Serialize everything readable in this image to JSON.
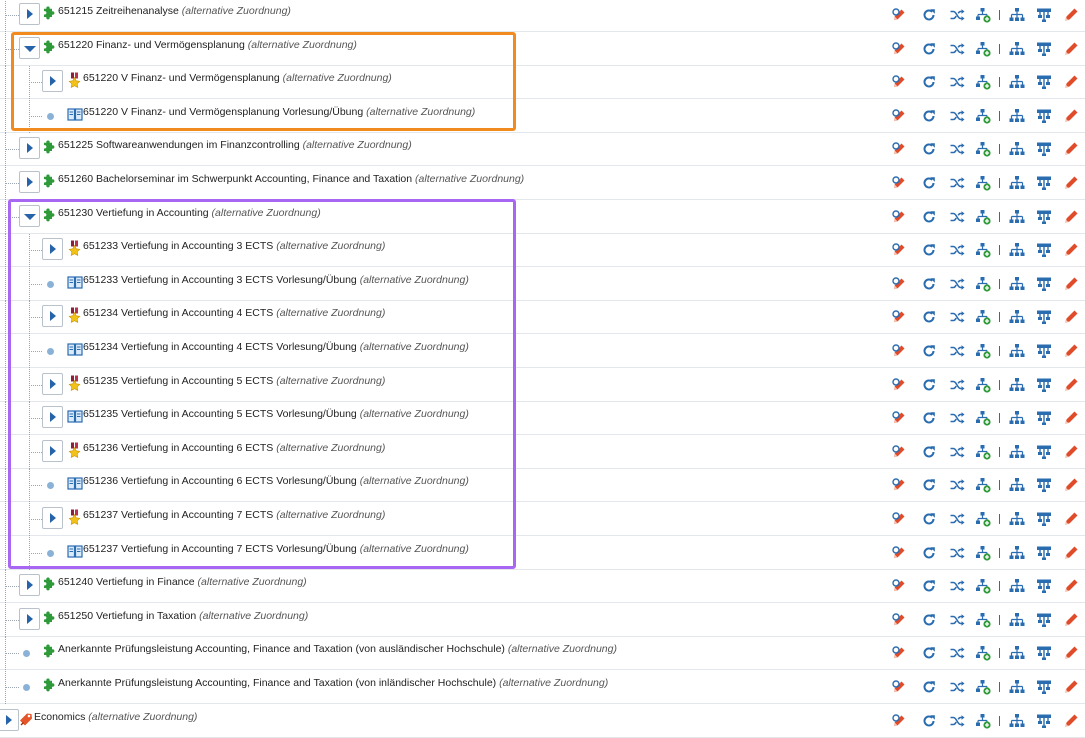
{
  "alt_label": "(alternative Zuordnung)",
  "colors": {
    "highlight_orange": "#f18a1f",
    "highlight_purple": "#a867f2",
    "toggle_arrow": "#2663a8",
    "action_blue": "#2a6cb0",
    "edit_red": "#e04b2a",
    "module_green": "#2e9a3a"
  },
  "action_icons": [
    "edit-pencil-icon",
    "refresh-icon",
    "shuffle-icon",
    "add-node-icon",
    "hierarchy-icon",
    "tree-structure-icon",
    "delete-pencil-icon"
  ],
  "rows": [
    {
      "level": 1,
      "toggle": "collapsed",
      "icon": "puzzle-icon",
      "title": "651215 Zeitreihenanalyse",
      "alt": true
    },
    {
      "level": 1,
      "toggle": "expanded",
      "icon": "puzzle-icon",
      "title": "651220 Finanz- und Vermögensplanung",
      "alt": true
    },
    {
      "level": 2,
      "toggle": "collapsed",
      "icon": "exam-medal-icon",
      "title": "651220 V Finanz- und Vermögensplanung",
      "alt": true
    },
    {
      "level": 2,
      "toggle": "leaf",
      "icon": "course-book-icon",
      "title": "651220 V Finanz- und Vermögensplanung Vorlesung/Übung",
      "alt": true
    },
    {
      "level": 1,
      "toggle": "collapsed",
      "icon": "puzzle-icon",
      "title": "651225 Softwareanwendungen im Finanzcontrolling",
      "alt": true
    },
    {
      "level": 1,
      "toggle": "collapsed",
      "icon": "puzzle-icon",
      "title": "651260 Bachelorseminar im Schwerpunkt Accounting, Finance and Taxation",
      "alt": true
    },
    {
      "level": 1,
      "toggle": "expanded",
      "icon": "puzzle-icon",
      "title": "651230 Vertiefung in Accounting",
      "alt": true
    },
    {
      "level": 2,
      "toggle": "collapsed",
      "icon": "exam-medal-icon",
      "title": "651233 Vertiefung in Accounting 3 ECTS",
      "alt": true
    },
    {
      "level": 2,
      "toggle": "leaf",
      "icon": "course-book-icon",
      "title": "651233 Vertiefung in Accounting 3 ECTS Vorlesung/Übung",
      "alt": true
    },
    {
      "level": 2,
      "toggle": "collapsed",
      "icon": "exam-medal-icon",
      "title": "651234 Vertiefung in Accounting 4 ECTS",
      "alt": true
    },
    {
      "level": 2,
      "toggle": "leaf",
      "icon": "course-book-icon",
      "title": "651234 Vertiefung in Accounting 4 ECTS Vorlesung/Übung",
      "alt": true
    },
    {
      "level": 2,
      "toggle": "collapsed",
      "icon": "exam-medal-icon",
      "title": "651235 Vertiefung in Accounting 5 ECTS",
      "alt": true
    },
    {
      "level": 2,
      "toggle": "collapsed",
      "icon": "course-book-icon",
      "title": "651235 Vertiefung in Accounting 5 ECTS Vorlesung/Übung",
      "alt": true
    },
    {
      "level": 2,
      "toggle": "collapsed",
      "icon": "exam-medal-icon",
      "title": "651236 Vertiefung in Accounting 6 ECTS",
      "alt": true
    },
    {
      "level": 2,
      "toggle": "leaf",
      "icon": "course-book-icon",
      "title": "651236 Vertiefung in Accounting 6 ECTS Vorlesung/Übung",
      "alt": true
    },
    {
      "level": 2,
      "toggle": "collapsed",
      "icon": "exam-medal-icon",
      "title": "651237 Vertiefung in Accounting 7 ECTS",
      "alt": true
    },
    {
      "level": 2,
      "toggle": "leaf",
      "icon": "course-book-icon",
      "title": "651237 Vertiefung in Accounting 7 ECTS Vorlesung/Übung",
      "alt": true
    },
    {
      "level": 1,
      "toggle": "collapsed",
      "icon": "puzzle-icon",
      "title": "651240 Vertiefung in Finance",
      "alt": true
    },
    {
      "level": 1,
      "toggle": "collapsed",
      "icon": "puzzle-icon",
      "title": "651250 Vertiefung in Taxation",
      "alt": true
    },
    {
      "level": 1,
      "toggle": "leaf",
      "icon": "puzzle-icon",
      "title": "Anerkannte Prüfungsleistung Accounting, Finance and Taxation (von ausländischer Hochschule)",
      "alt": true
    },
    {
      "level": 1,
      "toggle": "leaf",
      "icon": "puzzle-icon",
      "title": "Anerkannte Prüfungsleistung Accounting, Finance and Taxation (von inländischer Hochschule)",
      "alt": true
    },
    {
      "level": 0,
      "toggle": "collapsed",
      "icon": "area-tag-icon",
      "title": "Economics",
      "alt": true
    }
  ]
}
